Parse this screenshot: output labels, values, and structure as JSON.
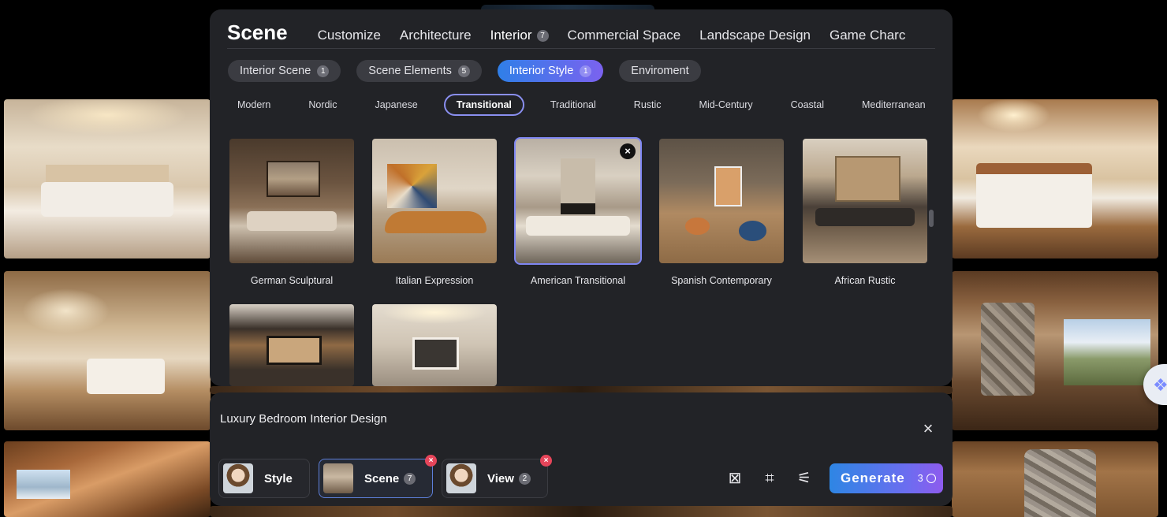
{
  "panel": {
    "title": "Scene",
    "categories": [
      {
        "label": "Customize"
      },
      {
        "label": "Architecture"
      },
      {
        "label": "Interior",
        "badge": "7"
      },
      {
        "label": "Commercial Space"
      },
      {
        "label": "Landscape Design"
      },
      {
        "label": "Game Charc"
      }
    ],
    "sub_tabs": [
      {
        "label": "Interior Scene",
        "badge": "1"
      },
      {
        "label": "Scene Elements",
        "badge": "5"
      },
      {
        "label": "Interior Style",
        "badge": "1"
      },
      {
        "label": "Enviroment"
      }
    ],
    "styles": [
      "Modern",
      "Nordic",
      "Japanese",
      "Transitional",
      "Traditional",
      "Rustic",
      "Mid-Century",
      "Coastal",
      "Mediterranean"
    ],
    "cards": [
      {
        "label": "German Sculptural"
      },
      {
        "label": "Italian Expression"
      },
      {
        "label": "American Transitional"
      },
      {
        "label": "Spanish Contemporary"
      },
      {
        "label": "African Rustic"
      }
    ],
    "close_glyph": "×"
  },
  "prompt": {
    "text": "Luxury Bedroom Interior Design",
    "close_glyph": "×",
    "buttons": [
      {
        "label": "Style"
      },
      {
        "label": "Scene",
        "badge": "7"
      },
      {
        "label": "View",
        "badge": "2"
      }
    ],
    "remove_glyph": "×",
    "tools": {
      "remove_prompt_icon": "⊠",
      "crop_icon": "⌗",
      "settings_icon": "⚟"
    },
    "generate": {
      "label": "Generate",
      "cost": "3"
    }
  },
  "colors": {
    "accent": "#7f86f2",
    "generate_start": "#2e86e4",
    "generate_end": "#8e5bee",
    "remove_red": "#e6455a",
    "panel_bg": "#222327"
  }
}
